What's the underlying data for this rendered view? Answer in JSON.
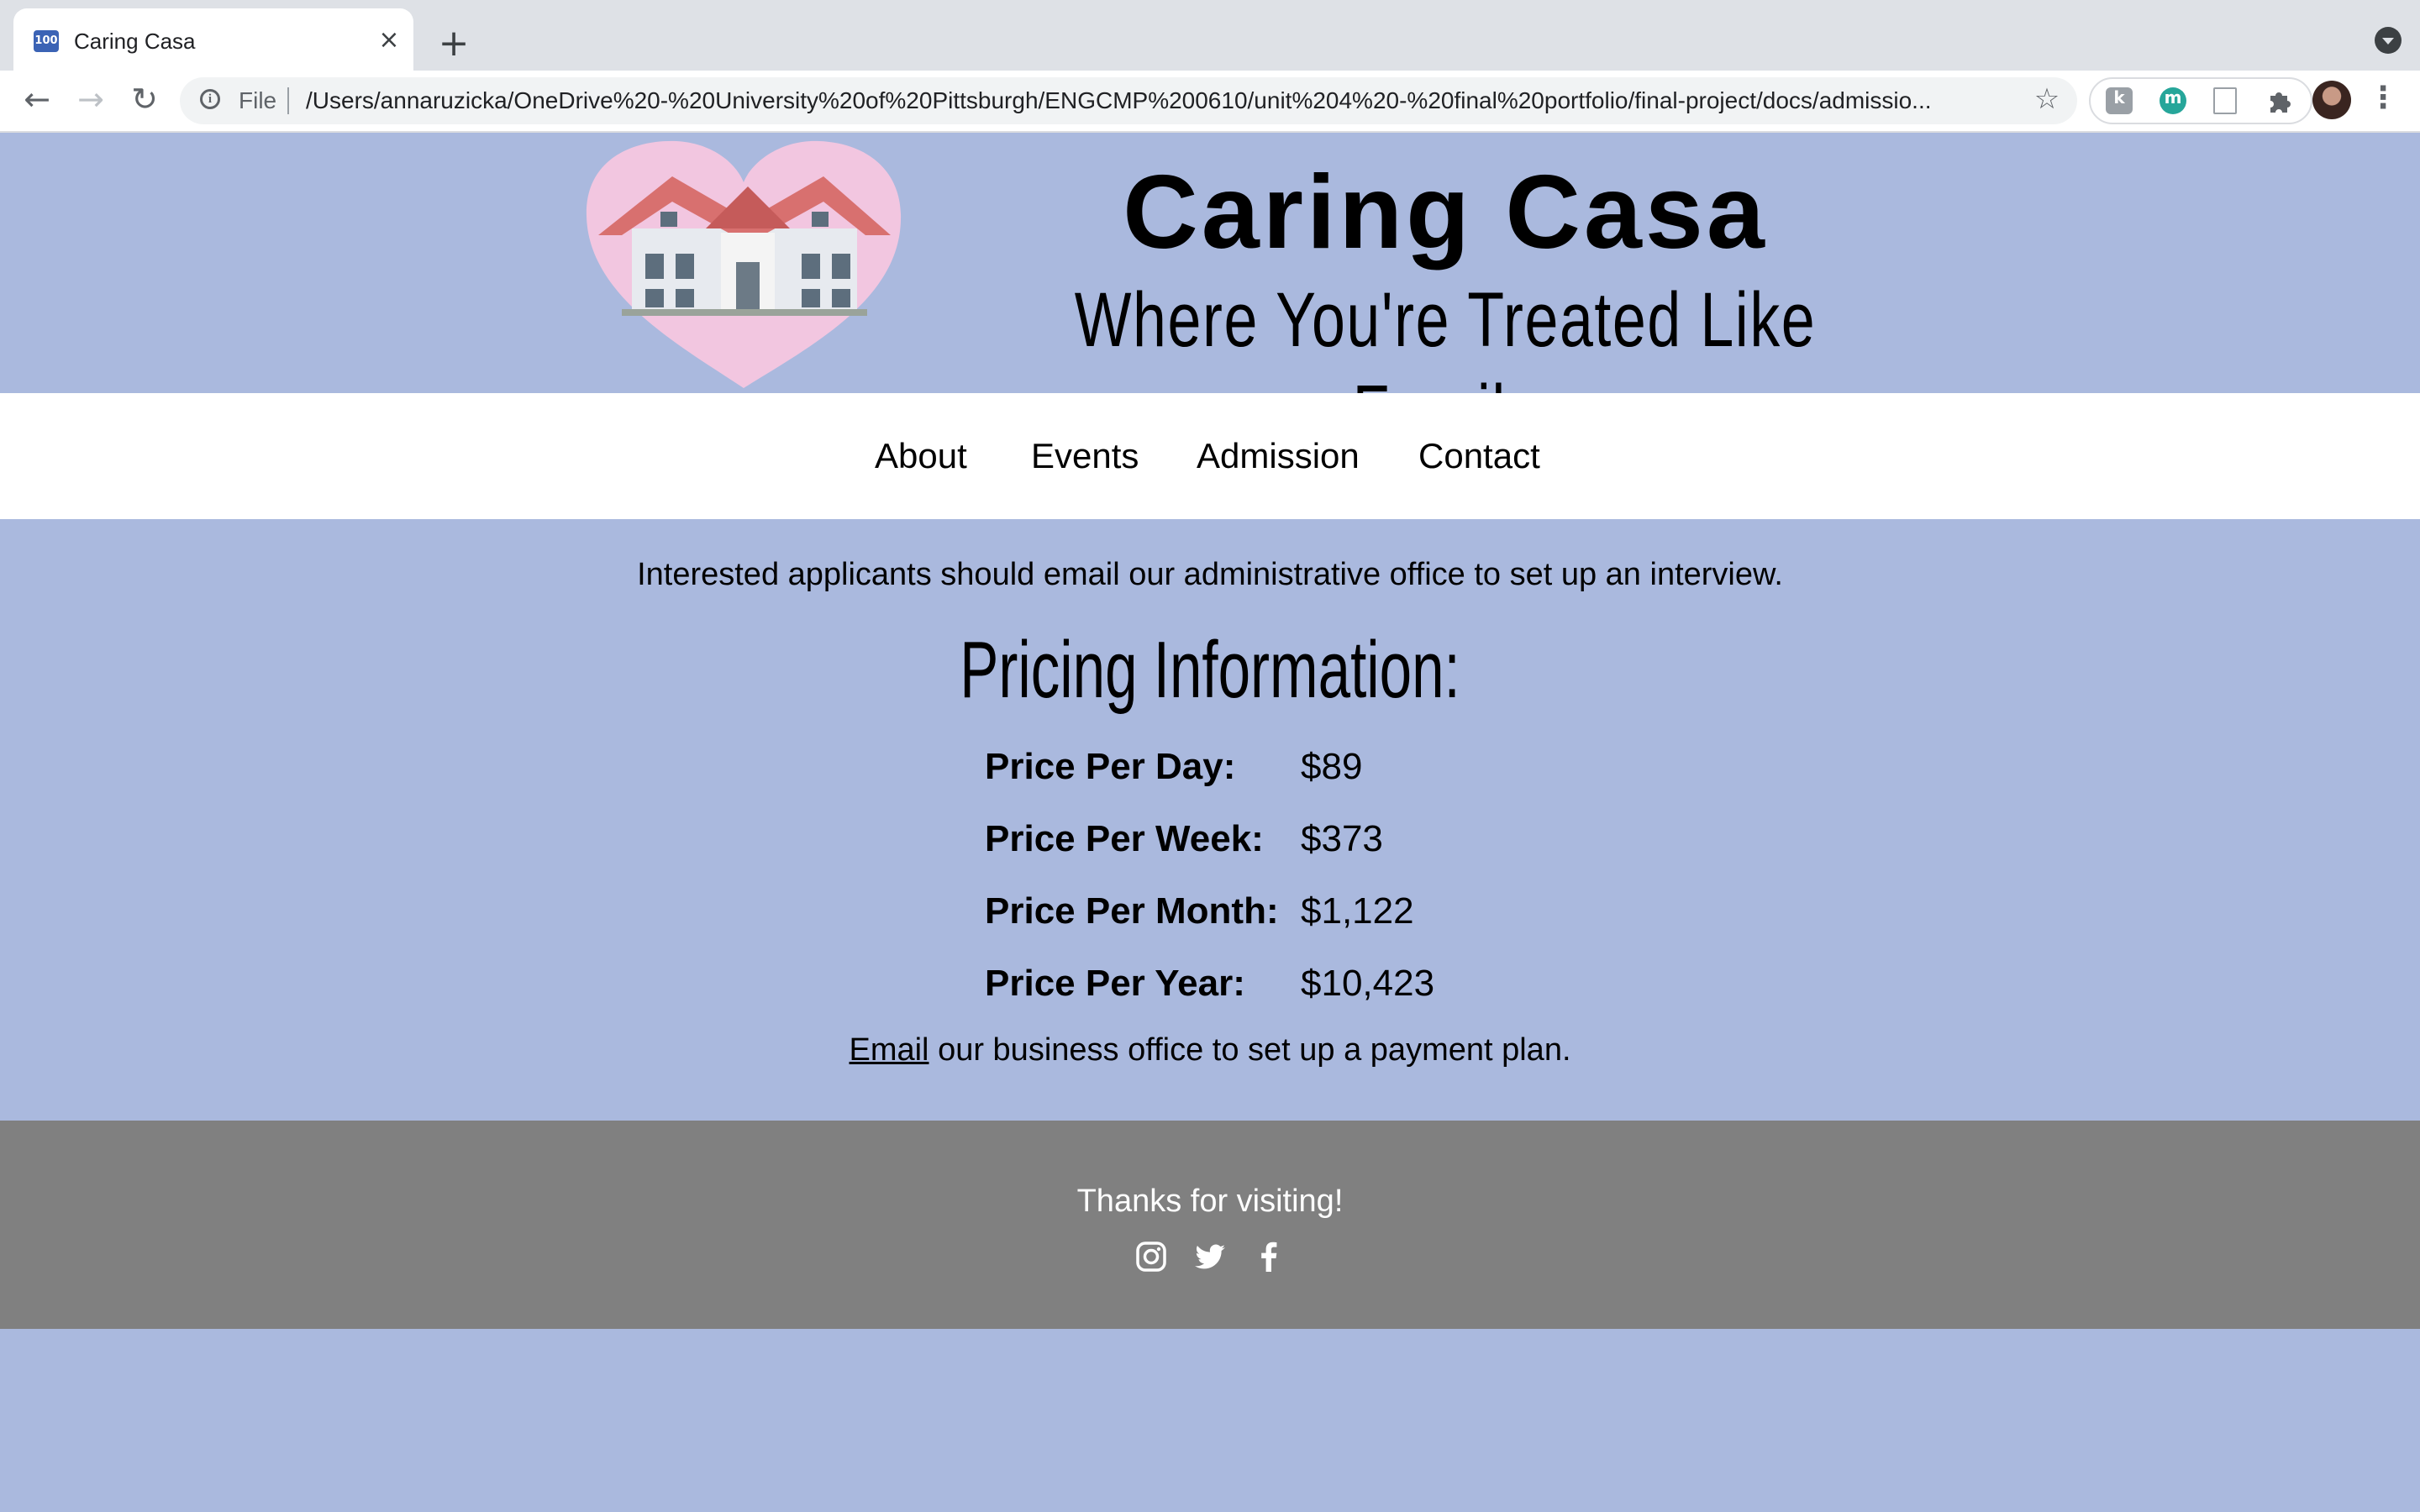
{
  "browser": {
    "tab": {
      "title": "Caring Casa",
      "favicon_text": "100"
    },
    "toolbar": {
      "scheme_label": "File",
      "url": "/Users/annaruzicka/OneDrive%20-%20University%20of%20Pittsburgh/ENGCMP%200610/unit%204%20-%20final%20portfolio/final-project/docs/admissio..."
    },
    "extensions": [
      {
        "name": "kami-extension-icon",
        "letter": "k",
        "color": "#9aa0a6"
      },
      {
        "name": "m-extension-icon",
        "letter": "m",
        "color": "#26a69a"
      },
      {
        "name": "document-extension-icon",
        "letter": "",
        "color": "#9aa0a6"
      },
      {
        "name": "puzzle-extensions-icon",
        "letter": "",
        "color": "#5f6368"
      }
    ]
  },
  "site": {
    "title": "Caring Casa",
    "tagline": "Where You're Treated Like Family",
    "nav": [
      "About",
      "Events",
      "Admission",
      "Contact"
    ]
  },
  "main": {
    "intro": "Interested applicants should email our administrative office to set up an interview.",
    "pricing_heading": "Pricing Information:",
    "prices": [
      {
        "label": "Price Per Day:",
        "value": "$89"
      },
      {
        "label": "Price Per Week:",
        "value": "$373"
      },
      {
        "label": "Price Per Month:",
        "value": "$1,122"
      },
      {
        "label": "Price Per Year:",
        "value": "$10,423"
      }
    ],
    "payment": {
      "link": "Email",
      "rest": " our business office to set up a payment plan."
    }
  },
  "footer": {
    "thanks": "Thanks for visiting!",
    "social": [
      "instagram-icon",
      "twitter-icon",
      "facebook-icon"
    ]
  },
  "colors": {
    "page_bg": "#aab9de",
    "nav_bg": "#ffffff",
    "footer_bg": "#808080",
    "logo_heart": "#f2c6e0"
  }
}
